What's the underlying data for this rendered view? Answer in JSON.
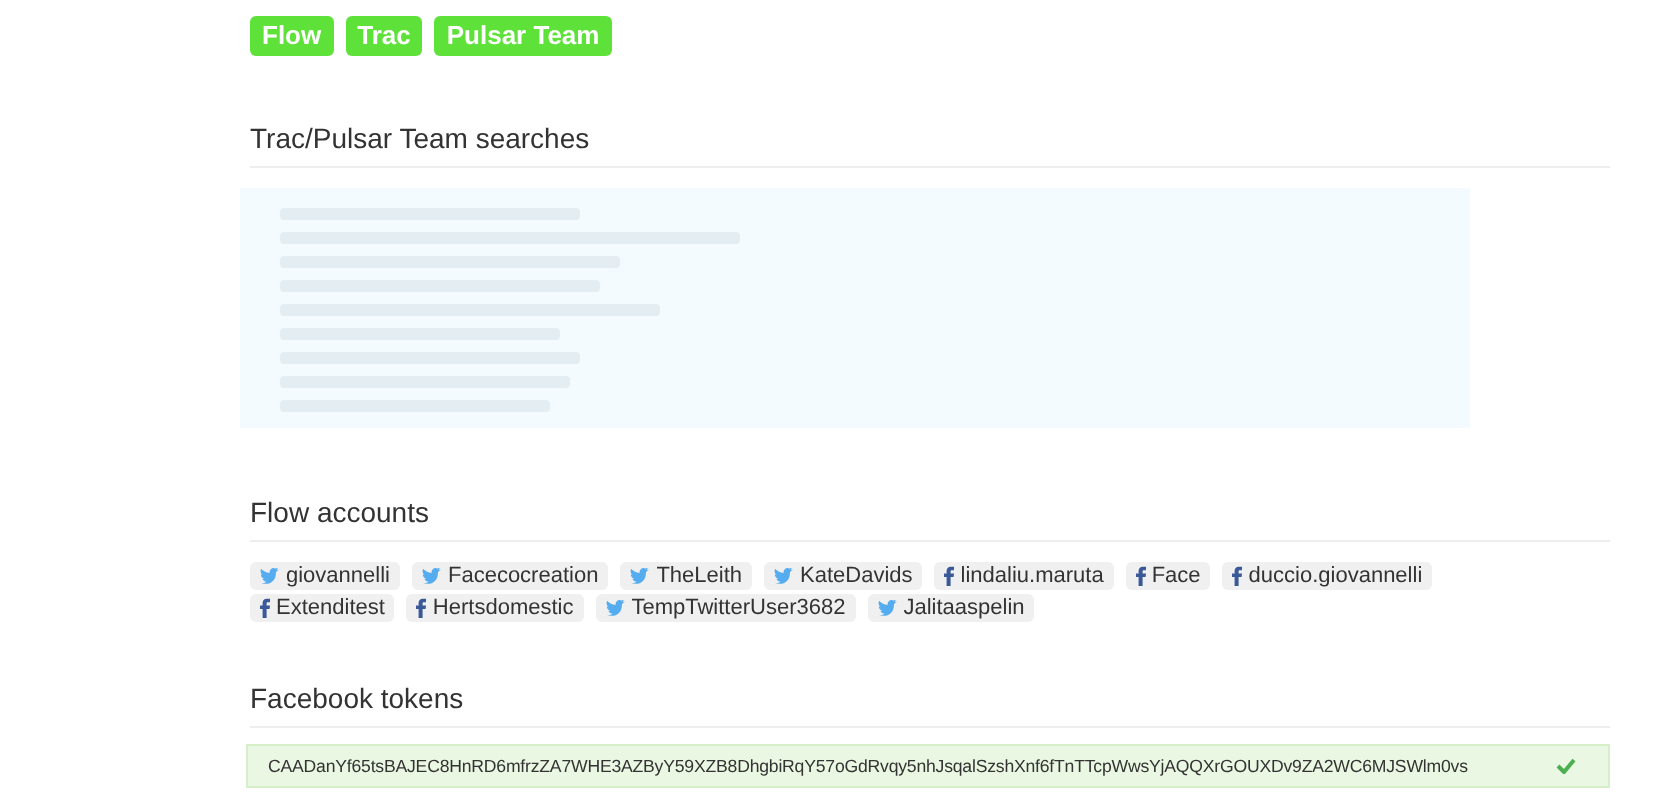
{
  "nav_buttons": [
    {
      "label": "Flow"
    },
    {
      "label": "Trac"
    },
    {
      "label": "Pulsar Team"
    }
  ],
  "searches": {
    "heading": "Trac/Pulsar Team searches"
  },
  "accounts": {
    "heading": "Flow accounts",
    "items": [
      {
        "kind": "twitter",
        "name": "giovannelli"
      },
      {
        "kind": "twitter",
        "name": "Facecocreation"
      },
      {
        "kind": "twitter",
        "name": "TheLeith"
      },
      {
        "kind": "twitter",
        "name": "KateDavids"
      },
      {
        "kind": "facebook",
        "name": "lindaliu.maruta"
      },
      {
        "kind": "facebook",
        "name": "Face"
      },
      {
        "kind": "facebook",
        "name": "duccio.giovannelli"
      },
      {
        "kind": "facebook",
        "name": "Extenditest"
      },
      {
        "kind": "facebook",
        "name": "Hertsdomestic"
      },
      {
        "kind": "twitter",
        "name": "TempTwitterUser3682"
      },
      {
        "kind": "twitter",
        "name": "Jalitaaspelin"
      }
    ]
  },
  "tokens": {
    "heading": "Facebook tokens",
    "items": [
      {
        "token": "CAADanYf65tsBAJEC8HnRD6mfrzZA7WHE3AZByY59XZB8DhgbiRqY57oGdRvqy5nhJsqalSzshXnf6fTnTTcpWwsYjAQQXrGOUXDv9ZA2WC6MJSWlm0vs",
        "valid": true
      }
    ]
  }
}
